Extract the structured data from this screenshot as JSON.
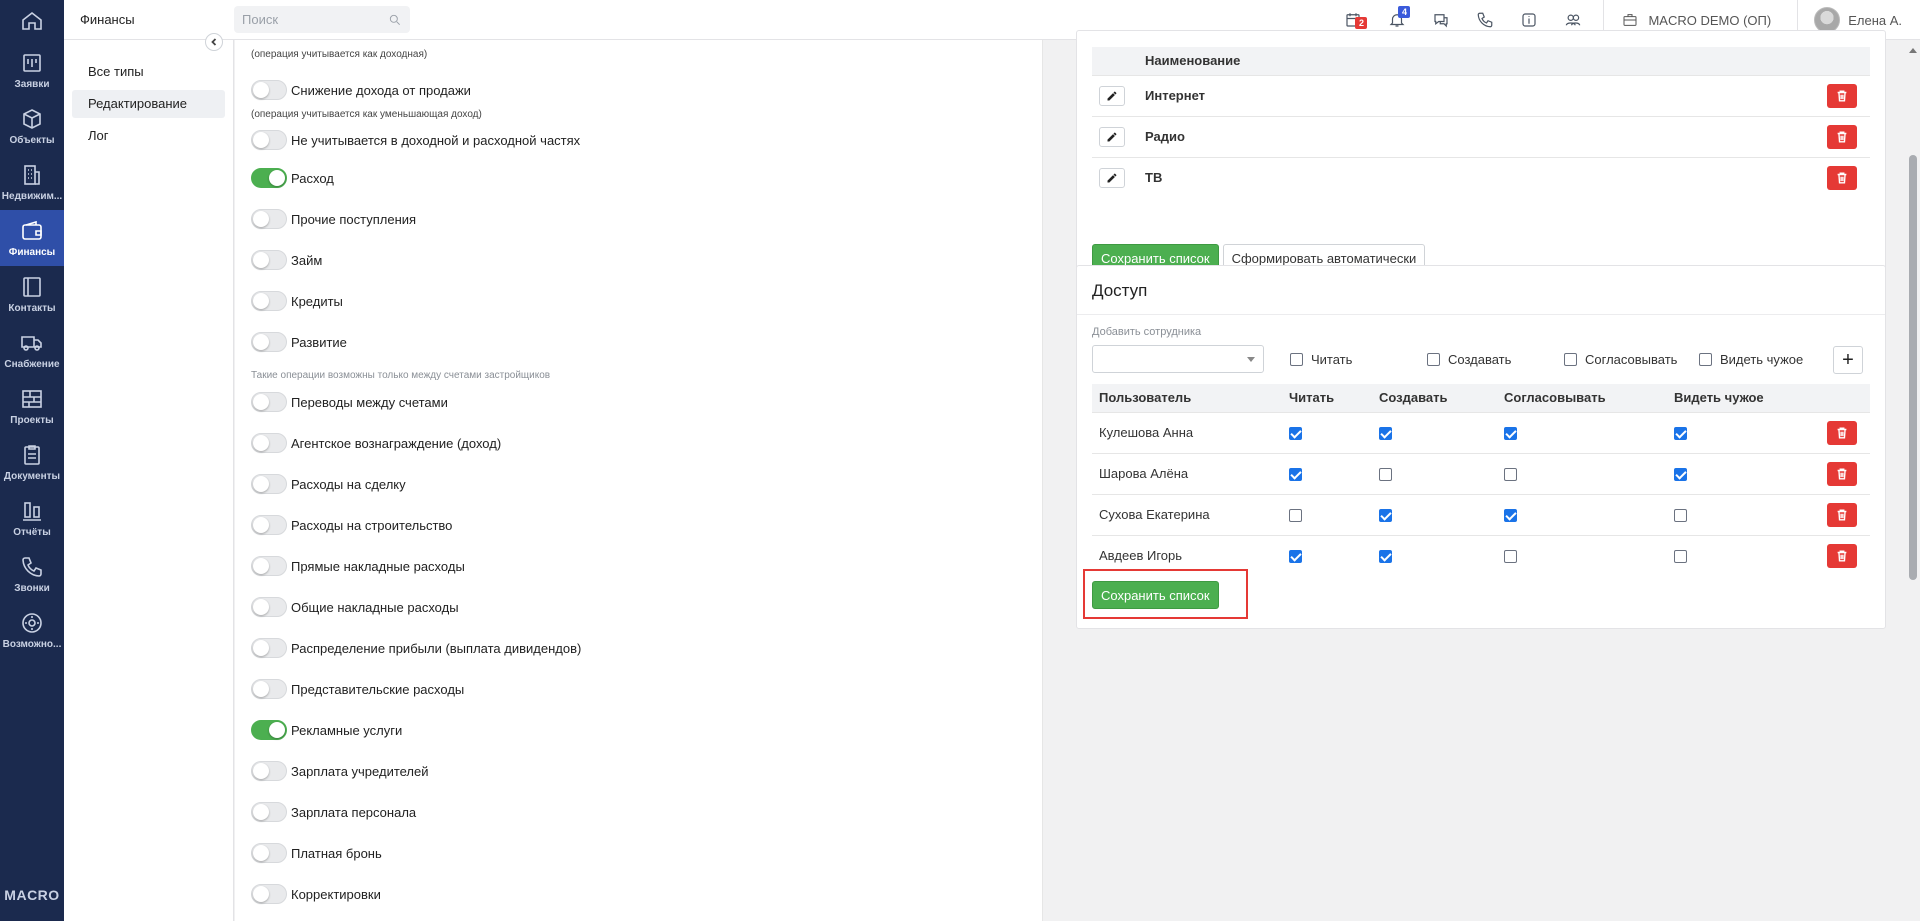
{
  "nav": {
    "items": [
      {
        "label": "Заявки",
        "icon": "requests-icon"
      },
      {
        "label": "Объекты",
        "icon": "box-icon"
      },
      {
        "label": "Недвижим...",
        "icon": "building-icon"
      },
      {
        "label": "Финансы",
        "icon": "wallet-icon"
      },
      {
        "label": "Контакты",
        "icon": "contacts-icon"
      },
      {
        "label": "Снабжение",
        "icon": "truck-icon"
      },
      {
        "label": "Проекты",
        "icon": "projects-icon"
      },
      {
        "label": "Документы",
        "icon": "documents-icon"
      },
      {
        "label": "Отчёты",
        "icon": "reports-icon"
      },
      {
        "label": "Звонки",
        "icon": "phone-icon"
      },
      {
        "label": "Возможно...",
        "icon": "settings-icon"
      }
    ],
    "logo": "MACRO"
  },
  "topbar": {
    "section": "Финансы",
    "search_placeholder": "Поиск",
    "calendar_badge": "2",
    "notifications_badge": "4",
    "company": "MACRO DEMO (ОП)",
    "user": "Елена А."
  },
  "subnav": {
    "items": [
      "Все типы",
      "Редактирование",
      "Лог"
    ]
  },
  "types": {
    "top_hint": "(операция учитывается как доходная)",
    "rows": [
      {
        "label": "Снижение дохода от продажи",
        "on": false,
        "hint": "(операция учитывается как уменьшающая доход)"
      },
      {
        "label": "Не учитывается в доходной и расходной частях",
        "on": false
      },
      {
        "label": "Расход",
        "on": true
      },
      {
        "label": "Прочие поступления",
        "on": false
      },
      {
        "label": "Займ",
        "on": false
      },
      {
        "label": "Кредиты",
        "on": false
      },
      {
        "label": "Развитие",
        "on": false,
        "hint": "Такие операции возможны только между счетами застройщиков"
      },
      {
        "label": "Переводы между счетами",
        "on": false
      },
      {
        "label": "Агентское вознаграждение (доход)",
        "on": false
      },
      {
        "label": "Расходы на сделку",
        "on": false
      },
      {
        "label": "Расходы на строительство",
        "on": false
      },
      {
        "label": "Прямые накладные расходы",
        "on": false
      },
      {
        "label": "Общие накладные расходы",
        "on": false
      },
      {
        "label": "Распределение прибыли (выплата дивидендов)",
        "on": false
      },
      {
        "label": "Представительские расходы",
        "on": false
      },
      {
        "label": "Рекламные услуги",
        "on": true
      },
      {
        "label": "Зарплата учредителей",
        "on": false
      },
      {
        "label": "Зарплата персонала",
        "on": false
      },
      {
        "label": "Платная бронь",
        "on": false
      },
      {
        "label": "Корректировки",
        "on": false
      }
    ]
  },
  "list_card": {
    "column_header": "Наименование",
    "items": [
      "Интернет",
      "Радио",
      "ТВ"
    ],
    "save_label": "Сохранить список",
    "auto_label": "Сформировать автоматически"
  },
  "access_card": {
    "title": "Доступ",
    "add_employee_label": "Добавить сотрудника",
    "options": [
      "Читать",
      "Создавать",
      "Согласовывать",
      "Видеть чужое"
    ],
    "headers": [
      "Пользователь",
      "Читать",
      "Создавать",
      "Согласовывать",
      "Видеть чужое"
    ],
    "rows": [
      {
        "user": "Кулешова Анна",
        "perms": [
          true,
          true,
          true,
          true
        ]
      },
      {
        "user": "Шарова Алёна",
        "perms": [
          true,
          false,
          false,
          true
        ]
      },
      {
        "user": "Сухова Екатерина",
        "perms": [
          false,
          true,
          true,
          false
        ]
      },
      {
        "user": "Авдеев Игорь",
        "perms": [
          true,
          true,
          false,
          false
        ]
      }
    ],
    "save_label": "Сохранить список"
  },
  "colors": {
    "nav_bg": "#1b2a4e",
    "nav_active": "#2f4fa8",
    "green": "#4caf50",
    "red": "#e53935",
    "check_blue": "#1a73e8"
  }
}
